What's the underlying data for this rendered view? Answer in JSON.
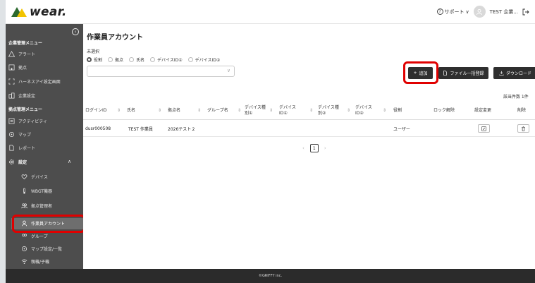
{
  "header": {
    "logo_text": "wear.",
    "support_label": "サポート",
    "user_label": "TEST 企業...",
    "colors": {
      "logo_green": "#2d6a2f",
      "logo_yellow": "#f2c400"
    }
  },
  "sidebar": {
    "company_menu_title": "企業管理メニュー",
    "company_items": [
      {
        "label": "アラート",
        "icon": "alert-icon"
      },
      {
        "label": "拠点",
        "icon": "building-icon"
      },
      {
        "label": "ハーネスアイ設定画面",
        "icon": "harness-icon"
      },
      {
        "label": "企業設定",
        "icon": "company-icon"
      }
    ],
    "site_menu_title": "拠点管理メニュー",
    "site_items": [
      {
        "label": "アクティビティ",
        "icon": "activity-icon"
      },
      {
        "label": "マップ",
        "icon": "map-pin-icon"
      },
      {
        "label": "レポート",
        "icon": "report-icon"
      },
      {
        "label": "設定",
        "icon": "gear-icon"
      }
    ],
    "settings_items": [
      {
        "label": "デバイス",
        "icon": "heart-icon"
      },
      {
        "label": "WBGT機器",
        "icon": "thermometer-icon"
      },
      {
        "label": "拠点管理者",
        "icon": "users-icon"
      },
      {
        "label": "作業員アカウント",
        "icon": "user-icon"
      },
      {
        "label": "グループ",
        "icon": "group-icon"
      },
      {
        "label": "マップ設定/一覧",
        "icon": "map-settings-icon"
      },
      {
        "label": "親機/子機",
        "icon": "wifi-icon"
      }
    ],
    "active_color": "#6e6e6e",
    "highlight_color": "#e00000"
  },
  "main": {
    "title": "作業員アカウント",
    "filter_label": "未選択",
    "radios": [
      "役割",
      "拠点",
      "氏名",
      "デバイスID①",
      "デバイスID②"
    ],
    "selected_radio": "役割",
    "buttons": {
      "add": "追加",
      "bulk": "ファイル一括登録",
      "download": "ダウンロード"
    },
    "count_label": "該当件数 1件",
    "columns": [
      "ログインID",
      "氏名",
      "拠点名",
      "グループ名",
      "デバイス種別①",
      "デバイスID①",
      "デバイス種別②",
      "デバイスID②",
      "役割",
      "ロック解除",
      "設定変更",
      "削除"
    ],
    "rows": [
      {
        "login_id": "dusr000508",
        "name": "TEST 作業員",
        "site": "2026テスト２",
        "role": "ユーザー"
      }
    ],
    "pager": {
      "current": "1"
    }
  },
  "footer": {
    "copyright": "©GRIFFY inc."
  }
}
